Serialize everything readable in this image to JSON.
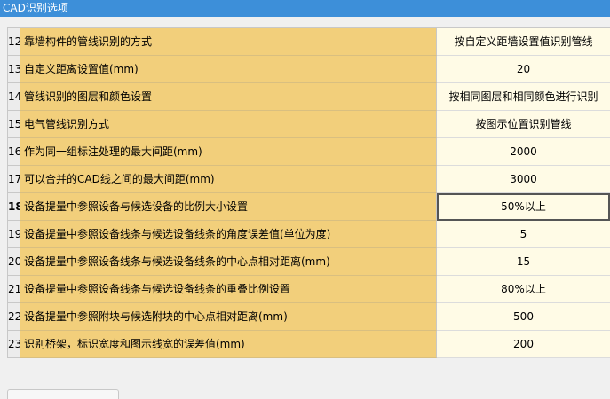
{
  "window": {
    "title": "CAD识别选项"
  },
  "rows": [
    {
      "num": "12",
      "label": "靠墙构件的管线识别的方式",
      "value": "按自定义距墙设置值识别管线"
    },
    {
      "num": "13",
      "label": "自定义距离设置值(mm)",
      "value": "20"
    },
    {
      "num": "14",
      "label": "管线识别的图层和颜色设置",
      "value": "按相同图层和相同颜色进行识别"
    },
    {
      "num": "15",
      "label": "电气管线识别方式",
      "value": "按图示位置识别管线"
    },
    {
      "num": "16",
      "label": "作为同一组标注处理的最大间距(mm)",
      "value": "2000"
    },
    {
      "num": "17",
      "label": "可以合并的CAD线之间的最大间距(mm)",
      "value": "3000"
    },
    {
      "num": "18",
      "label": "设备提量中参照设备与候选设备的比例大小设置",
      "value": "50%以上"
    },
    {
      "num": "19",
      "label": "设备提量中参照设备线条与候选设备线条的角度误差值(单位为度)",
      "value": "5"
    },
    {
      "num": "20",
      "label": "设备提量中参照设备线条与候选设备线条的中心点相对距离(mm)",
      "value": "15"
    },
    {
      "num": "21",
      "label": "设备提量中参照设备线条与候选设备线条的重叠比例设置",
      "value": "80%以上"
    },
    {
      "num": "22",
      "label": "设备提量中参照附块与候选附块的中心点相对距离(mm)",
      "value": "500"
    },
    {
      "num": "23",
      "label": "识别桥架，标识宽度和图示线宽的误差值(mm)",
      "value": "200"
    }
  ],
  "selected_row": "18"
}
